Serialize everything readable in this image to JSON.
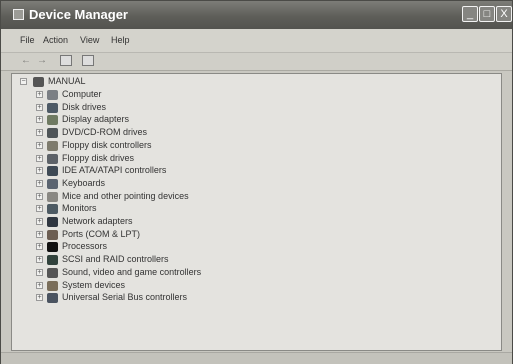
{
  "window": {
    "title": "Device Manager",
    "controls": {
      "minimize": "_",
      "maximize": "□",
      "close": "X"
    }
  },
  "menu": [
    {
      "label": "File"
    },
    {
      "label": "Action"
    },
    {
      "label": "View"
    },
    {
      "label": "Help"
    }
  ],
  "toolbar": {
    "back_icon": "←",
    "forward_icon": "→"
  },
  "tree": {
    "root": "MANUAL",
    "expander_collapsed": "+",
    "expander_expanded": "−",
    "items": [
      {
        "label": "Computer",
        "icon": "computer-icon"
      },
      {
        "label": "Disk drives",
        "icon": "disk-drive-icon"
      },
      {
        "label": "Display adapters",
        "icon": "display-adapter-icon"
      },
      {
        "label": "DVD/CD-ROM drives",
        "icon": "cdrom-icon"
      },
      {
        "label": "Floppy disk controllers",
        "icon": "floppy-controller-icon"
      },
      {
        "label": "Floppy disk drives",
        "icon": "floppy-drive-icon"
      },
      {
        "label": "IDE ATA/ATAPI controllers",
        "icon": "ide-controller-icon"
      },
      {
        "label": "Keyboards",
        "icon": "keyboard-icon"
      },
      {
        "label": "Mice and other pointing devices",
        "icon": "mouse-icon"
      },
      {
        "label": "Monitors",
        "icon": "monitor-icon"
      },
      {
        "label": "Network adapters",
        "icon": "network-adapter-icon"
      },
      {
        "label": "Ports (COM & LPT)",
        "icon": "port-icon"
      },
      {
        "label": "Processors",
        "icon": "processor-icon"
      },
      {
        "label": "SCSI and RAID controllers",
        "icon": "scsi-icon"
      },
      {
        "label": "Sound, video and game controllers",
        "icon": "sound-icon"
      },
      {
        "label": "System devices",
        "icon": "system-device-icon"
      },
      {
        "label": "Universal Serial Bus controllers",
        "icon": "usb-icon"
      }
    ]
  }
}
